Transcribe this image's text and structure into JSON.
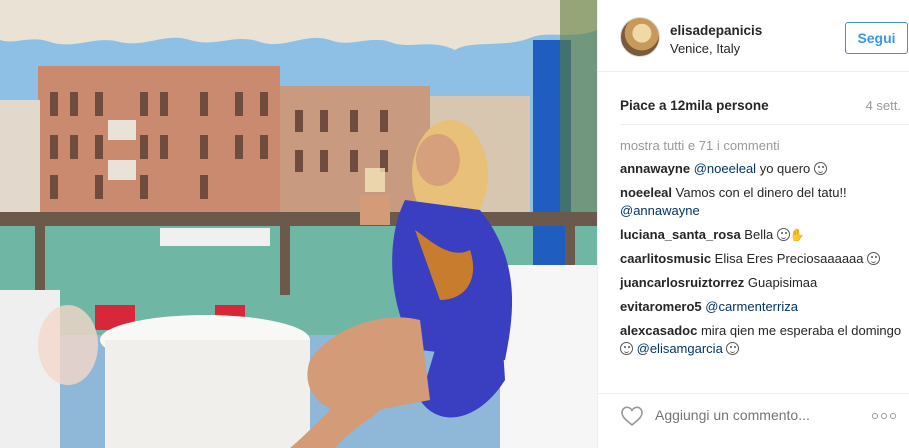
{
  "user": {
    "username": "elisadepanicis",
    "location": "Venice, Italy",
    "follow_label": "Segui"
  },
  "post": {
    "likes": "Piace a 12mila persone",
    "time": "4 sett.",
    "show_all": "mostra tutti e 71 i commenti"
  },
  "comments": [
    {
      "user": "annawayne",
      "mention": "@noeeleal",
      "text": " yo quero ",
      "emoji": "face"
    },
    {
      "user": "noeeleal",
      "text": " Vamos con el dinero del tatu!! ",
      "mention_after": "@annawayne"
    },
    {
      "user": "luciana_santa_rosa",
      "text": " Bella ",
      "emoji": "face"
    },
    {
      "user": "caarlitosmusic",
      "text": " Elisa Eres Preciosaaaaaa ",
      "emoji": "face"
    },
    {
      "user": "juancarlosruiztorrez",
      "text": " Guapisimaa"
    },
    {
      "user": "evitaromero5",
      "mention": "@carmenterriza",
      "text": ""
    },
    {
      "user": "alexcasadoc",
      "text": " mira qien me esperaba el domingo",
      "mention_after": "@elisamgarcia"
    }
  ],
  "footer": {
    "add_comment_placeholder": "Aggiungi un commento..."
  },
  "icons": {
    "like": "heart-icon",
    "more": "more-options-icon",
    "emoji": "smiley-icon"
  },
  "colors": {
    "follow_border": "#4090db",
    "follow_text": "#3897f0",
    "mention": "#003569",
    "muted": "#999999"
  }
}
